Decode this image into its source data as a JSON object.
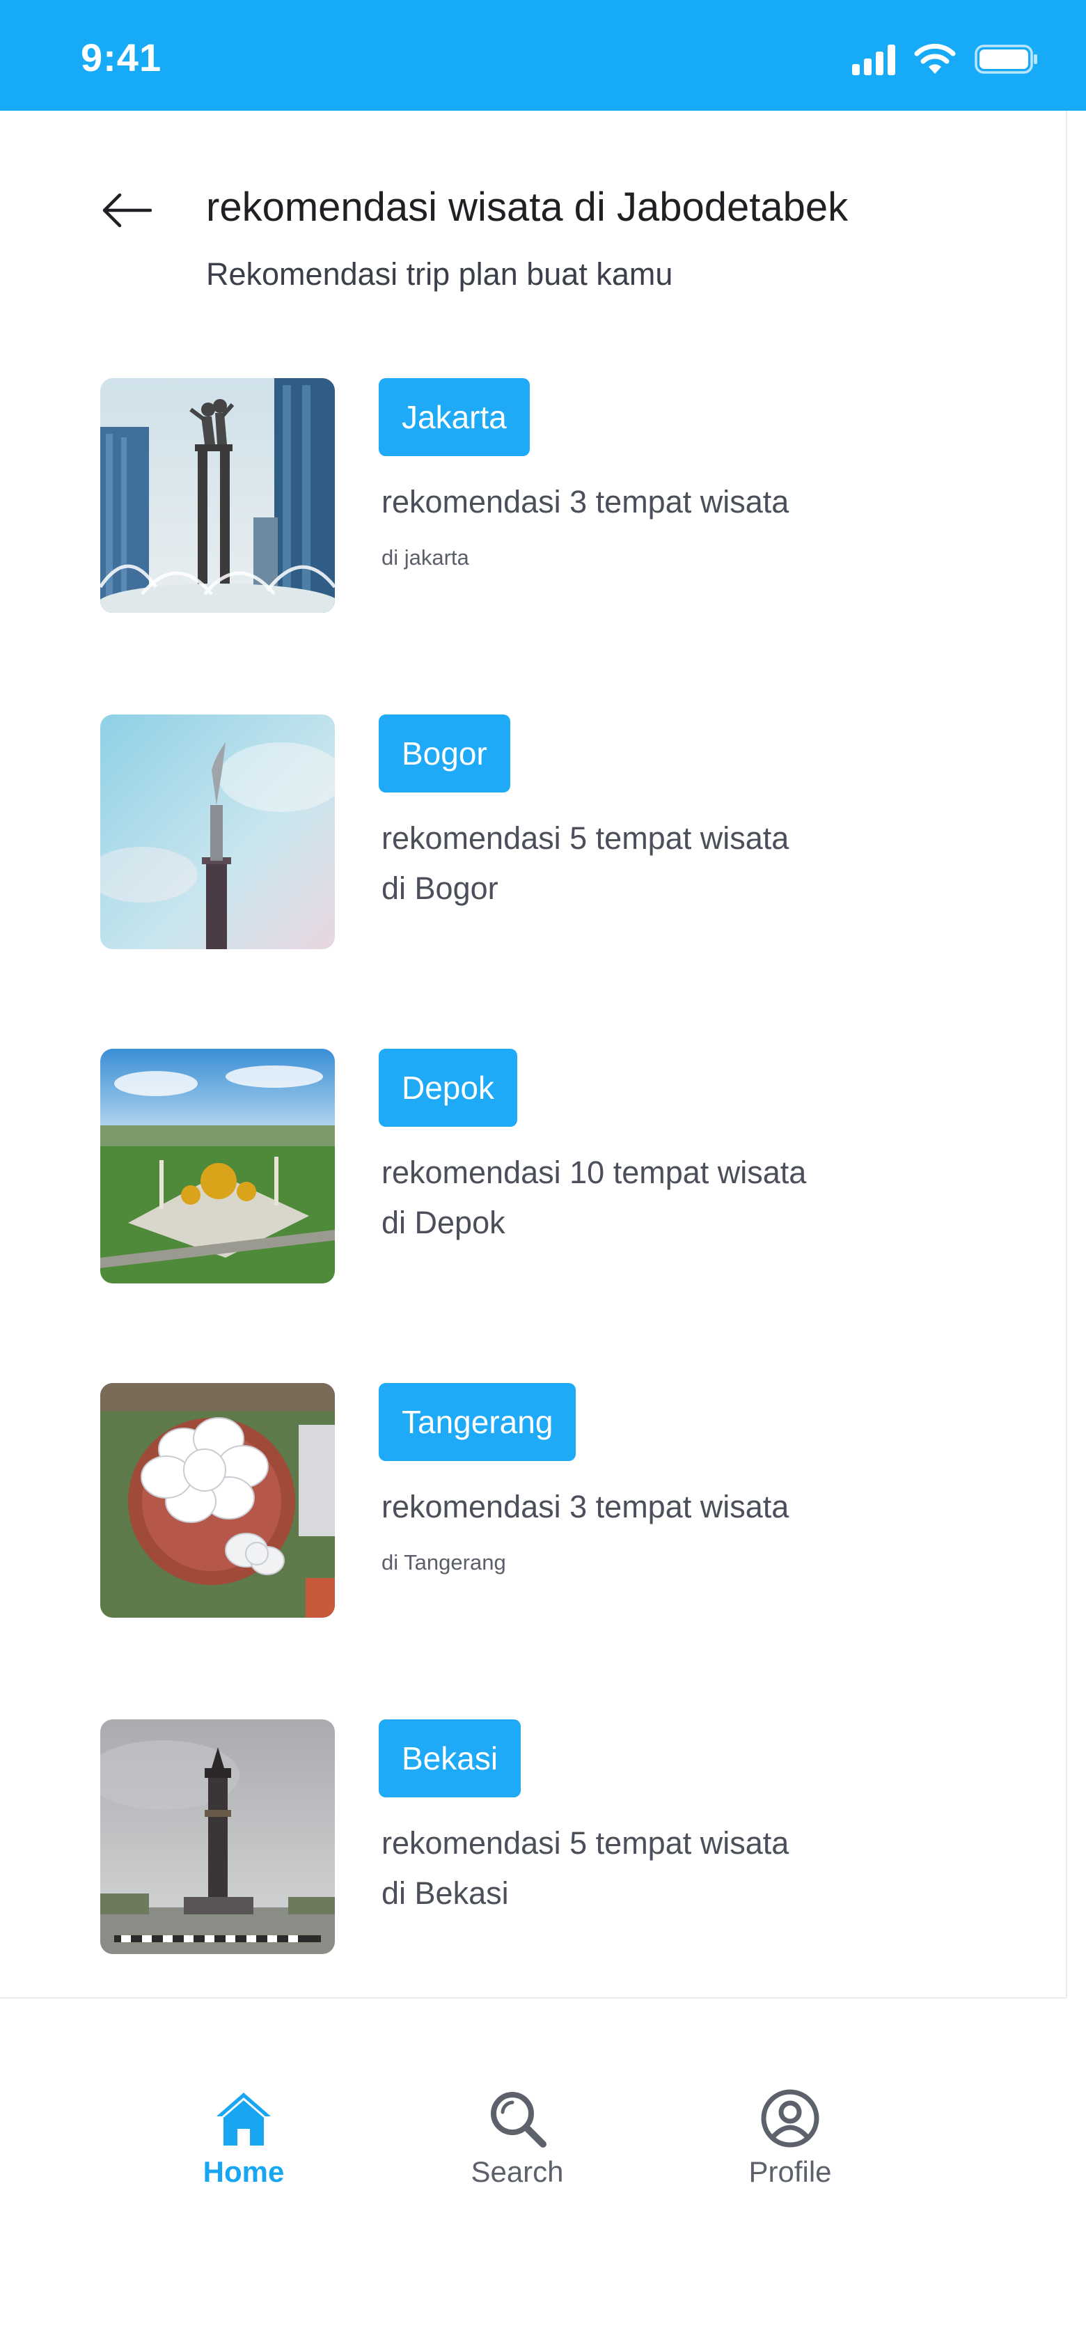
{
  "status_bar": {
    "time": "9:41"
  },
  "header": {
    "title": "rekomendasi wisata di Jabodetabek",
    "subtitle": "Rekomendasi trip plan buat kamu"
  },
  "cities": [
    {
      "tag": "Jakarta",
      "line1": "rekomendasi 3 tempat wisata",
      "line2": "di jakarta",
      "image": "monument-statue-skyscrapers"
    },
    {
      "tag": "Bogor",
      "line1": "rekomendasi 5 tempat wisata",
      "line2": "di Bogor",
      "image": "tall-monument-sky"
    },
    {
      "tag": "Depok",
      "line1": "rekomendasi 10 tempat wisata",
      "line2": "di Depok",
      "image": "golden-dome-mosque"
    },
    {
      "tag": "Tangerang",
      "line1": "rekomendasi 3 tempat wisata",
      "line2": "di Tangerang",
      "image": "aerial-white-domes"
    },
    {
      "tag": "Bekasi",
      "line1": "rekomendasi 5 tempat wisata",
      "line2": "di Bekasi",
      "image": "clock-tower-roundabout"
    }
  ],
  "bottom_nav": {
    "items": [
      {
        "label": "Home",
        "icon": "home-icon",
        "active": true
      },
      {
        "label": "Search",
        "icon": "search-icon",
        "active": false
      },
      {
        "label": "Profile",
        "icon": "profile-icon",
        "active": false
      }
    ]
  },
  "colors": {
    "accent": "#17aaf7",
    "text": "#1f1f24",
    "muted": "#4a4f5a"
  }
}
